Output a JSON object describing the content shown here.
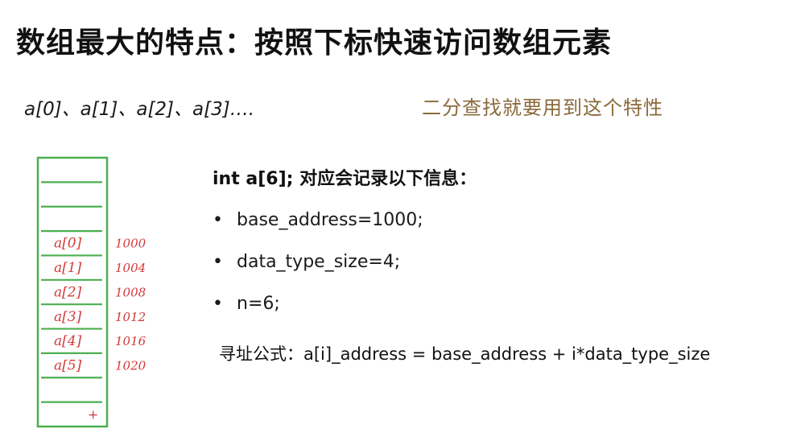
{
  "title": "数组最大的特点：按照下标快速访问数组元素",
  "index_sequence": "a[0]、a[1]、a[2]、a[3]….",
  "side_note": "二分查找就要用到这个特性",
  "declaration": "int a[6]; 对应会记录以下信息：",
  "info_items": [
    "base_address=1000;",
    "data_type_size=4;",
    "n=6;"
  ],
  "formula": "寻址公式：a[i]_address = base_address + i*data_type_size",
  "memory": {
    "cells": [
      {
        "label": "",
        "address": ""
      },
      {
        "label": "",
        "address": ""
      },
      {
        "label": "",
        "address": ""
      },
      {
        "label": "a[0]",
        "address": "1000"
      },
      {
        "label": "a[1]",
        "address": "1004"
      },
      {
        "label": "a[2]",
        "address": "1008"
      },
      {
        "label": "a[3]",
        "address": "1012"
      },
      {
        "label": "a[4]",
        "address": "1016"
      },
      {
        "label": "a[5]",
        "address": "1020"
      },
      {
        "label": "",
        "address": ""
      },
      {
        "label": "+",
        "address": ""
      }
    ],
    "line_color": "#4caf50",
    "ink_color": "#d23a3a"
  },
  "bullet_symbol": "•",
  "accent_color": "#8a6a3c"
}
